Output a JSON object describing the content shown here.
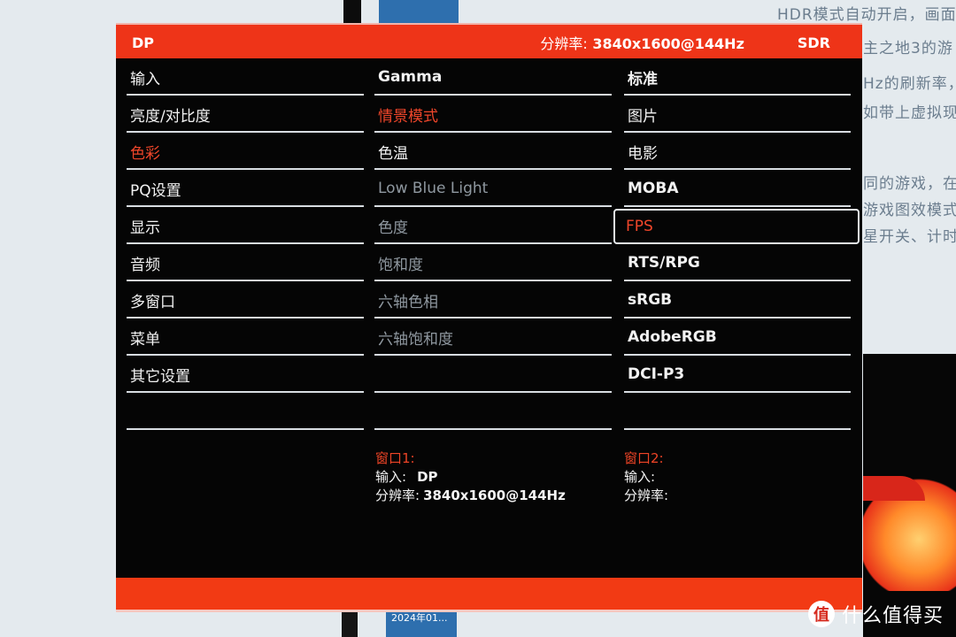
{
  "background": {
    "article_snippets": [
      "HDR模式自动开启，画面",
      "主之地3的游",
      "Hz的刷新率，",
      "如带上虚拟现",
      "同的游戏，在",
      "游戏图效模式",
      "星开关、计时"
    ],
    "taskbar_tile_label": "2024年01...",
    "watermark": {
      "badge": "值",
      "text": "什么值得买"
    }
  },
  "osd": {
    "header": {
      "input": "DP",
      "resolution_label": "分辨率:",
      "resolution_value": "3840x1600@144Hz",
      "dynamic_range": "SDR"
    },
    "main_menu": [
      {
        "label": "输入",
        "state": "normal"
      },
      {
        "label": "亮度/对比度",
        "state": "normal"
      },
      {
        "label": "色彩",
        "state": "active"
      },
      {
        "label": "PQ设置",
        "state": "normal"
      },
      {
        "label": "显示",
        "state": "normal"
      },
      {
        "label": "音频",
        "state": "normal"
      },
      {
        "label": "多窗口",
        "state": "normal"
      },
      {
        "label": "菜单",
        "state": "normal"
      },
      {
        "label": "其它设置",
        "state": "normal"
      },
      {
        "label": "",
        "state": "normal"
      }
    ],
    "color_menu": [
      {
        "label": "Gamma",
        "state": "normal"
      },
      {
        "label": "情景模式",
        "state": "active"
      },
      {
        "label": "色温",
        "state": "normal"
      },
      {
        "label": "Low Blue Light",
        "state": "disabled"
      },
      {
        "label": "色度",
        "state": "disabled"
      },
      {
        "label": "饱和度",
        "state": "disabled"
      },
      {
        "label": "六轴色相",
        "state": "disabled"
      },
      {
        "label": "六轴饱和度",
        "state": "disabled"
      },
      {
        "label": "",
        "state": "normal"
      },
      {
        "label": "",
        "state": "normal"
      }
    ],
    "scene_mode_options": [
      {
        "label": "标准",
        "state": "normal"
      },
      {
        "label": "图片",
        "state": "normal"
      },
      {
        "label": "电影",
        "state": "normal"
      },
      {
        "label": "MOBA",
        "state": "normal"
      },
      {
        "label": "FPS",
        "state": "selected"
      },
      {
        "label": "RTS/RPG",
        "state": "normal"
      },
      {
        "label": "sRGB",
        "state": "normal"
      },
      {
        "label": "AdobeRGB",
        "state": "normal"
      },
      {
        "label": "DCI-P3",
        "state": "normal"
      },
      {
        "label": "",
        "state": "normal"
      }
    ],
    "window1": {
      "title": "窗口1:",
      "input_label": "输入:",
      "input_value": "DP",
      "resolution_label": "分辨率:",
      "resolution_value": "3840x1600@144Hz"
    },
    "window2": {
      "title": "窗口2:",
      "input_label": "输入:",
      "input_value": "",
      "resolution_label": "分辨率:",
      "resolution_value": ""
    },
    "colors": {
      "accent_red": "#ee3418",
      "active_text": "#f0462a",
      "disabled_text": "#8f98a0",
      "panel_bg": "#050505"
    }
  }
}
